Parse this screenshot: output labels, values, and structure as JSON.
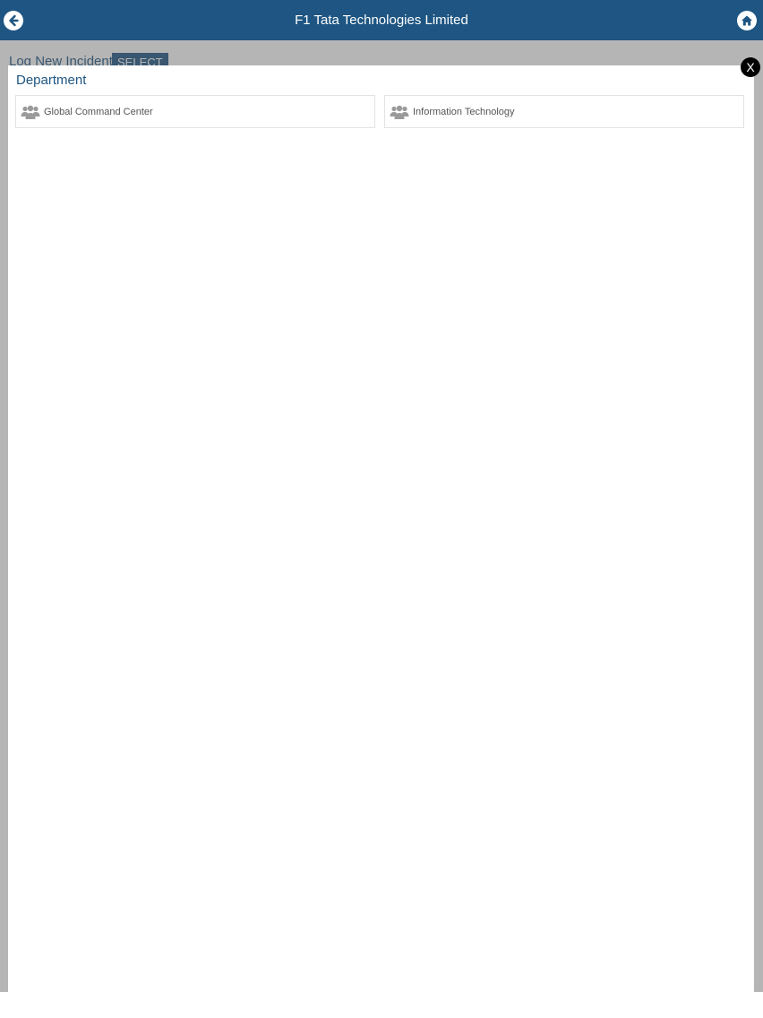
{
  "header": {
    "title": "F1 Tata Technologies Limited",
    "back_icon": "back-arrow-icon",
    "home_icon": "home-icon"
  },
  "page": {
    "incident_label": "Log New Incident",
    "select_label": "SELECT"
  },
  "modal": {
    "title": "Department",
    "close_label": "X",
    "items": [
      {
        "label": "Global Command Center",
        "icon": "group-icon"
      },
      {
        "label": "Information Technology",
        "icon": "group-icon"
      }
    ]
  },
  "colors": {
    "header_bg": "#1e5582",
    "accent": "#1e5582",
    "item_text": "#555555",
    "icon_gray": "#9a9a9a"
  }
}
